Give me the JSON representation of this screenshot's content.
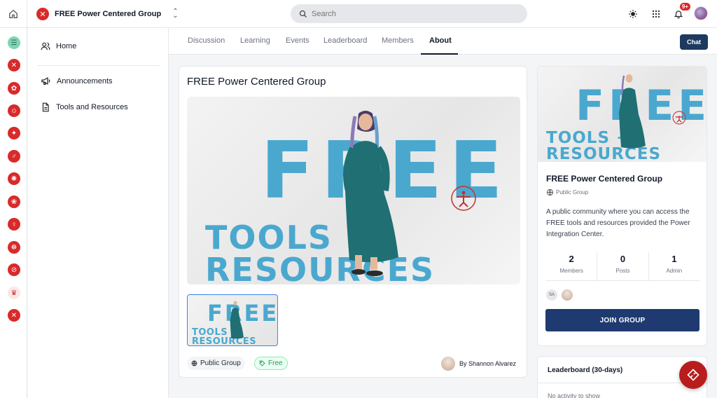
{
  "topbar": {
    "group_name": "FREE Power Centered Group",
    "search_placeholder": "Search",
    "notification_count": "9+"
  },
  "sidebar": {
    "items": [
      {
        "label": "Home",
        "icon": "people-icon"
      },
      {
        "label": "Announcements",
        "icon": "megaphone-icon"
      },
      {
        "label": "Tools and Resources",
        "icon": "document-icon"
      }
    ]
  },
  "tabs": [
    {
      "label": "Discussion"
    },
    {
      "label": "Learning"
    },
    {
      "label": "Events"
    },
    {
      "label": "Leaderboard"
    },
    {
      "label": "Members"
    },
    {
      "label": "About",
      "active": true
    }
  ],
  "chat_label": "Chat",
  "main": {
    "title": "FREE Power Centered Group",
    "banner_line1": "FREE",
    "banner_line2": "TOOLS + RESOURCES",
    "chip_public": "Public Group",
    "chip_free": "Free",
    "author": "By Shannon Alvarez"
  },
  "info": {
    "title": "FREE Power Centered Group",
    "subtitle": "Public Group",
    "description": "A public community where you can access the FREE tools and resources provided the Power Integration Center.",
    "stats": [
      {
        "value": "2",
        "label": "Members"
      },
      {
        "value": "0",
        "label": "Posts"
      },
      {
        "value": "1",
        "label": "Admin"
      }
    ],
    "member_initials": "SA",
    "join_label": "JOIN GROUP"
  },
  "leaderboard": {
    "title": "Leaderboard (30-days)",
    "empty": "No activity to show"
  },
  "colors": {
    "brand_red": "#d92a2a",
    "navy": "#1e3a70",
    "art_blue": "#4aa8cf",
    "dress_teal": "#1f6f73"
  }
}
